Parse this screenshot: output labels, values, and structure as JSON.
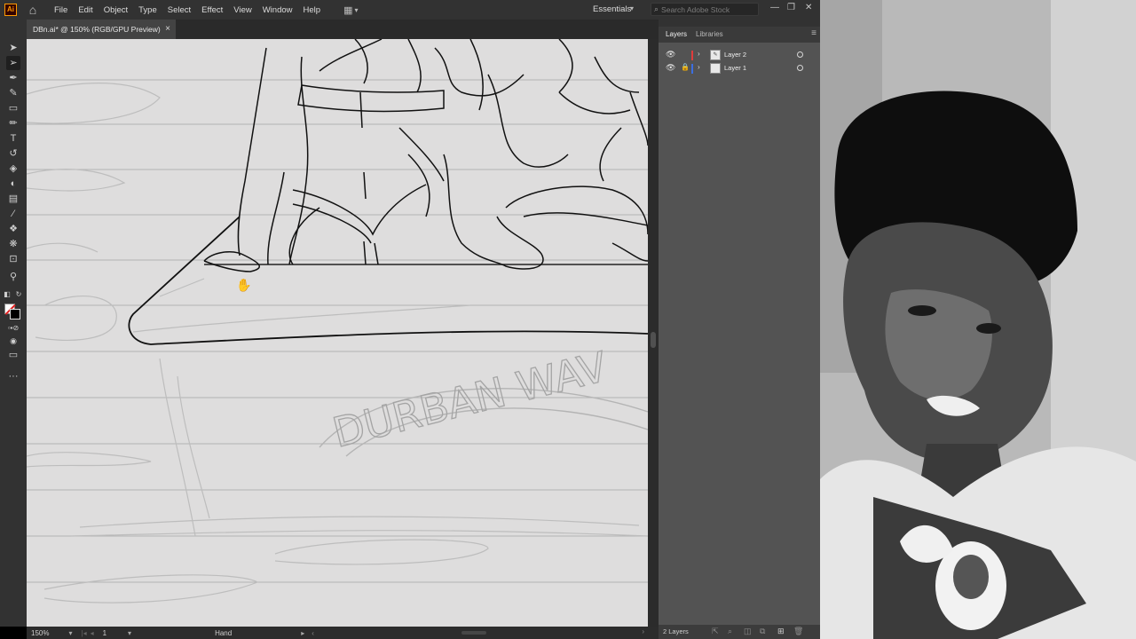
{
  "app": {
    "logo": "Ai"
  },
  "menu": [
    "File",
    "Edit",
    "Object",
    "Type",
    "Select",
    "Effect",
    "View",
    "Window",
    "Help"
  ],
  "workspace": {
    "label": "Essentials"
  },
  "search": {
    "placeholder": "Search Adobe Stock"
  },
  "window_controls": {
    "minimize": "—",
    "restore": "❐",
    "close": "✕"
  },
  "document_tab": {
    "label": "DBn.ai* @ 150% (RGB/GPU Preview)",
    "close": "×"
  },
  "canvas_text": {
    "lettering": "DURBAN WAV"
  },
  "statusbar": {
    "zoom": "150%",
    "artboard": "1",
    "tool": "Hand"
  },
  "panel": {
    "tabs": [
      "Layers",
      "Libraries"
    ],
    "layers": [
      {
        "name": "Layer 2",
        "color": "#e03c3c",
        "locked": false
      },
      {
        "name": "Layer 1",
        "color": "#3c6ee0",
        "locked": true
      }
    ],
    "footer": {
      "count": "2 Layers"
    }
  },
  "icons": {
    "home": "home-icon",
    "search": "search-icon",
    "eye": "eye-icon",
    "lock": "lock-icon",
    "expand": "chevron-right-icon",
    "hand": "hand-cursor-icon"
  }
}
